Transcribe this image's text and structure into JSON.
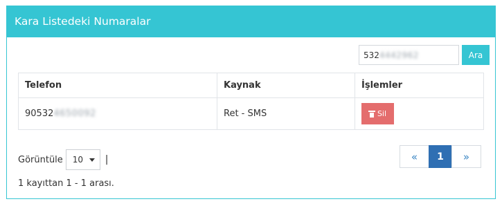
{
  "panel": {
    "title": "Kara Listedeki Numaralar"
  },
  "search": {
    "value_prefix": "532",
    "value_hidden": "4442962",
    "button_label": "Ara"
  },
  "table": {
    "headers": [
      "Telefon",
      "Kaynak",
      "İşlemler"
    ],
    "rows": [
      {
        "phone_prefix": "90532",
        "phone_hidden": "4650092",
        "source": "Ret - SMS",
        "action_label": "Sil",
        "action_icon": "trash-icon"
      }
    ]
  },
  "page_size": {
    "label": "Görüntüle",
    "value": "10",
    "separator": "|"
  },
  "record_info": "1 kayıttan 1 - 1 arası.",
  "pagination": {
    "prev": "«",
    "current": "1",
    "next": "»"
  },
  "colors": {
    "accent": "#35c5d3",
    "danger": "#e46d6d",
    "page_active": "#2f6fb3"
  }
}
